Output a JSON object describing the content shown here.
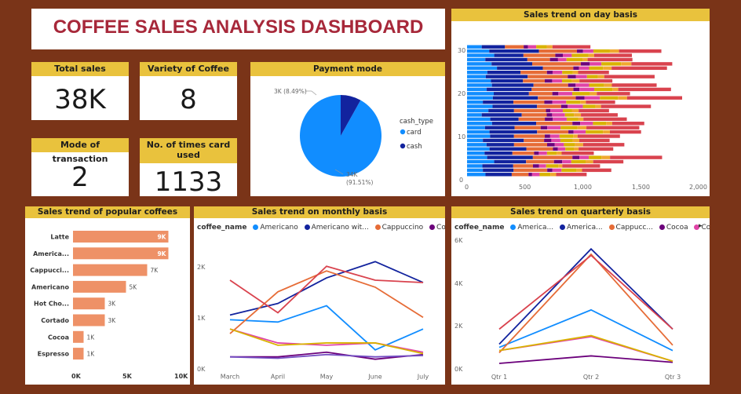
{
  "title": "COFFEE SALES ANALYSIS DASHBOARD",
  "kpis": {
    "total_sales": {
      "label": "Total sales",
      "value": "38K"
    },
    "variety": {
      "label": "Variety of Coffee",
      "value": "8"
    },
    "mode": {
      "label": "Mode of transaction",
      "value": "2"
    },
    "card_used": {
      "label": "No. of times card used",
      "value": "1133"
    }
  },
  "colors": {
    "americano": "#118dff",
    "americano_milk": "#12239e",
    "cappuccino": "#e66c37",
    "cocoa": "#6b007b",
    "cortado": "#e044a7",
    "latte": "#d9434e",
    "hot_chocolate": "#d9b300",
    "espresso": "#f0a830",
    "bar": "#ee9167",
    "header": "#e9c23d",
    "card": "#118dff",
    "cash": "#12239e"
  },
  "payment": {
    "title": "Payment mode",
    "legend_title": "cash_type",
    "cash_label": "3K (8.49%)",
    "card_label_1": "34K",
    "card_label_2": "(91.51%)",
    "card_legend": "card",
    "cash_legend": "cash"
  },
  "day_trend": {
    "title": "Sales trend on day basis",
    "yticks": [
      "30",
      "20",
      "10",
      "0"
    ],
    "xticks": [
      "0",
      "500",
      "1,000",
      "1,500",
      "2,000"
    ]
  },
  "popular": {
    "title": "Sales trend of popular coffees",
    "xticks": [
      "0K",
      "5K",
      "10K"
    ]
  },
  "monthly": {
    "title": "Sales trend on monthly basis",
    "legend_title": "coffee_name",
    "legend": [
      "Americano",
      "Americano wit...",
      "Cappuccino",
      "Cocoa"
    ],
    "yticks": [
      "2K",
      "1K",
      "0K"
    ]
  },
  "quarterly": {
    "title": "Sales trend on quarterly basis",
    "legend_title": "coffee_name",
    "legend": [
      "America...",
      "America...",
      "Cappucc...",
      "Cocoa",
      "Cortado"
    ],
    "yticks": [
      "6K",
      "4K",
      "2K",
      "0K"
    ]
  },
  "chart_data": [
    {
      "type": "pie",
      "title": "Payment mode",
      "categories": [
        "card",
        "cash"
      ],
      "values": [
        34,
        3
      ],
      "percent": [
        91.51,
        8.49
      ],
      "legend_title": "cash_type"
    },
    {
      "type": "bar",
      "orientation": "horizontal",
      "title": "Sales trend of popular coffees",
      "categories": [
        "Latte",
        "America...",
        "Cappucci...",
        "Americano",
        "Hot Cho...",
        "Cortado",
        "Cocoa",
        "Espresso"
      ],
      "values": [
        9,
        9,
        7,
        5,
        3,
        3,
        1,
        1
      ],
      "labels": [
        "9K",
        "9K",
        "7K",
        "5K",
        "3K",
        "3K",
        "1K",
        "1K"
      ],
      "xlim": [
        0,
        10
      ]
    },
    {
      "type": "line",
      "title": "Sales trend on monthly basis",
      "categories": [
        "March",
        "April",
        "May",
        "June",
        "July"
      ],
      "ylim": [
        0,
        2.5
      ],
      "series": [
        {
          "name": "Americano",
          "color": "#118dff",
          "values": [
            1.05,
            1.0,
            1.35,
            0.4,
            0.85
          ]
        },
        {
          "name": "Americano wit...",
          "color": "#12239e",
          "values": [
            1.15,
            1.4,
            1.95,
            2.3,
            1.85
          ]
        },
        {
          "name": "Cappuccino",
          "color": "#e66c37",
          "values": [
            0.75,
            1.65,
            2.1,
            1.75,
            1.1
          ]
        },
        {
          "name": "Cocoa",
          "color": "#6b007b",
          "values": [
            0.25,
            0.25,
            0.35,
            0.2,
            0.3
          ]
        },
        {
          "color": "#e044a7",
          "values": [
            0.85,
            0.55,
            0.5,
            0.55,
            0.35
          ]
        },
        {
          "color": "#d9434e",
          "values": [
            1.9,
            1.2,
            2.2,
            1.9,
            1.85
          ]
        },
        {
          "color": "#d9b300",
          "values": [
            0.85,
            0.5,
            0.55,
            0.55,
            0.32
          ]
        },
        {
          "color": "#744ec2",
          "values": [
            0.25,
            0.22,
            0.3,
            0.25,
            0.28
          ]
        }
      ]
    },
    {
      "type": "line",
      "title": "Sales trend on quarterly basis",
      "categories": [
        "Qtr 1",
        "Qtr 2",
        "Qtr 3"
      ],
      "ylim": [
        0,
        6
      ],
      "series": [
        {
          "name": "America...",
          "color": "#118dff",
          "values": [
            1.0,
            2.75,
            0.85
          ]
        },
        {
          "name": "America...",
          "color": "#12239e",
          "values": [
            1.15,
            5.6,
            1.85
          ]
        },
        {
          "name": "Cappucc...",
          "color": "#e66c37",
          "values": [
            0.75,
            5.35,
            1.1
          ]
        },
        {
          "name": "Cocoa",
          "color": "#6b007b",
          "values": [
            0.25,
            0.6,
            0.3
          ]
        },
        {
          "name": "Cortado",
          "color": "#e044a7",
          "values": [
            0.85,
            1.5,
            0.35
          ]
        },
        {
          "color": "#d9434e",
          "values": [
            1.85,
            5.3,
            1.85
          ]
        },
        {
          "color": "#d9b300",
          "values": [
            0.85,
            1.55,
            0.35
          ]
        }
      ]
    },
    {
      "type": "bar",
      "orientation": "horizontal",
      "stacked": true,
      "title": "Sales trend on day basis",
      "categories": [
        "1",
        "2",
        "3",
        "4",
        "5",
        "6",
        "7",
        "8",
        "9",
        "10",
        "11",
        "12",
        "13",
        "14",
        "15",
        "16",
        "17",
        "18",
        "19",
        "20",
        "21",
        "22",
        "23",
        "24",
        "25",
        "26",
        "27",
        "28",
        "29",
        "30",
        "31"
      ],
      "totals": [
        1000,
        1300,
        1100,
        1450,
        1550,
        1350,
        1200,
        1400,
        1300,
        1250,
        1500,
        1550,
        1400,
        1450,
        1300,
        1250,
        1500,
        1400,
        1600,
        1500,
        1700,
        1650,
        1300,
        1550,
        1450,
        1600,
        1900,
        1400,
        1450,
        1600,
        1200
      ],
      "xlim": [
        0,
        2000
      ],
      "ylim": [
        0,
        31
      ]
    }
  ]
}
